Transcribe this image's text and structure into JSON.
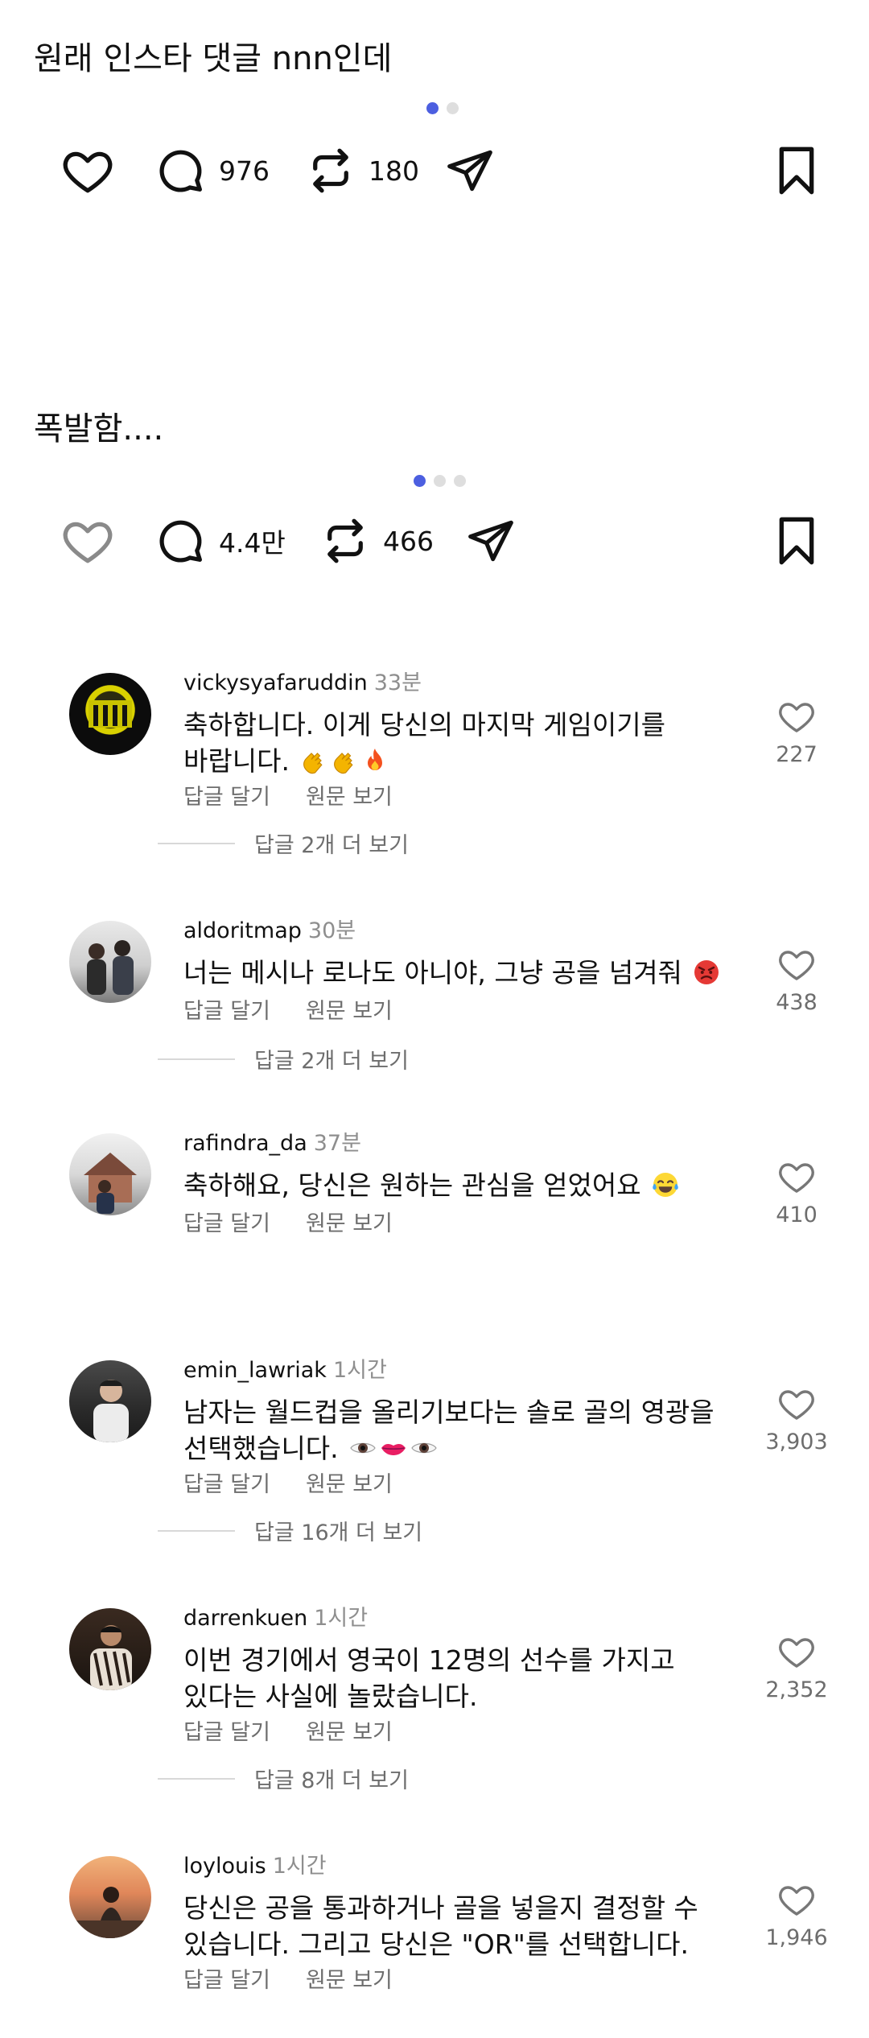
{
  "posts": [
    {
      "caption": "원래 인스타 댓글 nnn인데",
      "dots": 2,
      "active_dot": 0,
      "comments_count": "976",
      "reposts_count": "180"
    },
    {
      "caption": "폭발함....",
      "dots": 3,
      "active_dot": 0,
      "comments_count": "4.4만",
      "reposts_count": "466"
    }
  ],
  "comments": [
    {
      "username": "vickysyafaruddin",
      "time": "33분",
      "lines": [
        "축하합니다. 이게 당신의 마지막 게임이기를",
        "바랍니다."
      ],
      "emojis": [
        "clapping-hands",
        "clapping-hands",
        "fire"
      ],
      "likes": "227",
      "reply_label": "답글 달기",
      "original_label": "원문 보기",
      "more_replies": "답글 2개 더 보기"
    },
    {
      "username": "aldoritmap",
      "time": "30분",
      "lines": [
        "너는 메시나 로나도 아니야, 그냥 공을 넘겨줘"
      ],
      "emojis": [
        "angry-face"
      ],
      "likes": "438",
      "reply_label": "답글 달기",
      "original_label": "원문 보기",
      "more_replies": "답글 2개 더 보기"
    },
    {
      "username": "rafindra_da",
      "time": "37분",
      "lines": [
        "축하해요, 당신은 원하는 관심을 얻었어요"
      ],
      "emojis": [
        "tears-of-joy-face"
      ],
      "likes": "410",
      "reply_label": "답글 달기",
      "original_label": "원문 보기",
      "more_replies": ""
    },
    {
      "username": "emin_lawriak",
      "time": "1시간",
      "lines": [
        "남자는 월드컵을 올리기보다는 솔로 골의 영광을",
        "선택했습니다."
      ],
      "emojis": [
        "eye",
        "lips",
        "eye"
      ],
      "likes": "3,903",
      "reply_label": "답글 달기",
      "original_label": "원문 보기",
      "more_replies": "답글 16개 더 보기"
    },
    {
      "username": "darrenkuen",
      "time": "1시간",
      "lines": [
        "이번 경기에서 영국이 12명의 선수를 가지고",
        "있다는 사실에 놀랐습니다."
      ],
      "emojis": [],
      "likes": "2,352",
      "reply_label": "답글 달기",
      "original_label": "원문 보기",
      "more_replies": "답글 8개 더 보기"
    },
    {
      "username": "loylouis",
      "time": "1시간",
      "lines": [
        "당신은 공을 통과하거나 골을 넣을지 결정할 수",
        "있습니다. 그리고 당신은 \"OR\"를 선택합니다."
      ],
      "emojis": [],
      "likes": "1,946",
      "reply_label": "답글 달기",
      "original_label": "원문 보기",
      "more_replies": ""
    }
  ],
  "colors": {
    "accent_dot": "#4c5fe0",
    "inactive_dot": "#dedede",
    "text": "#111111",
    "muted": "#6d6d6d"
  }
}
